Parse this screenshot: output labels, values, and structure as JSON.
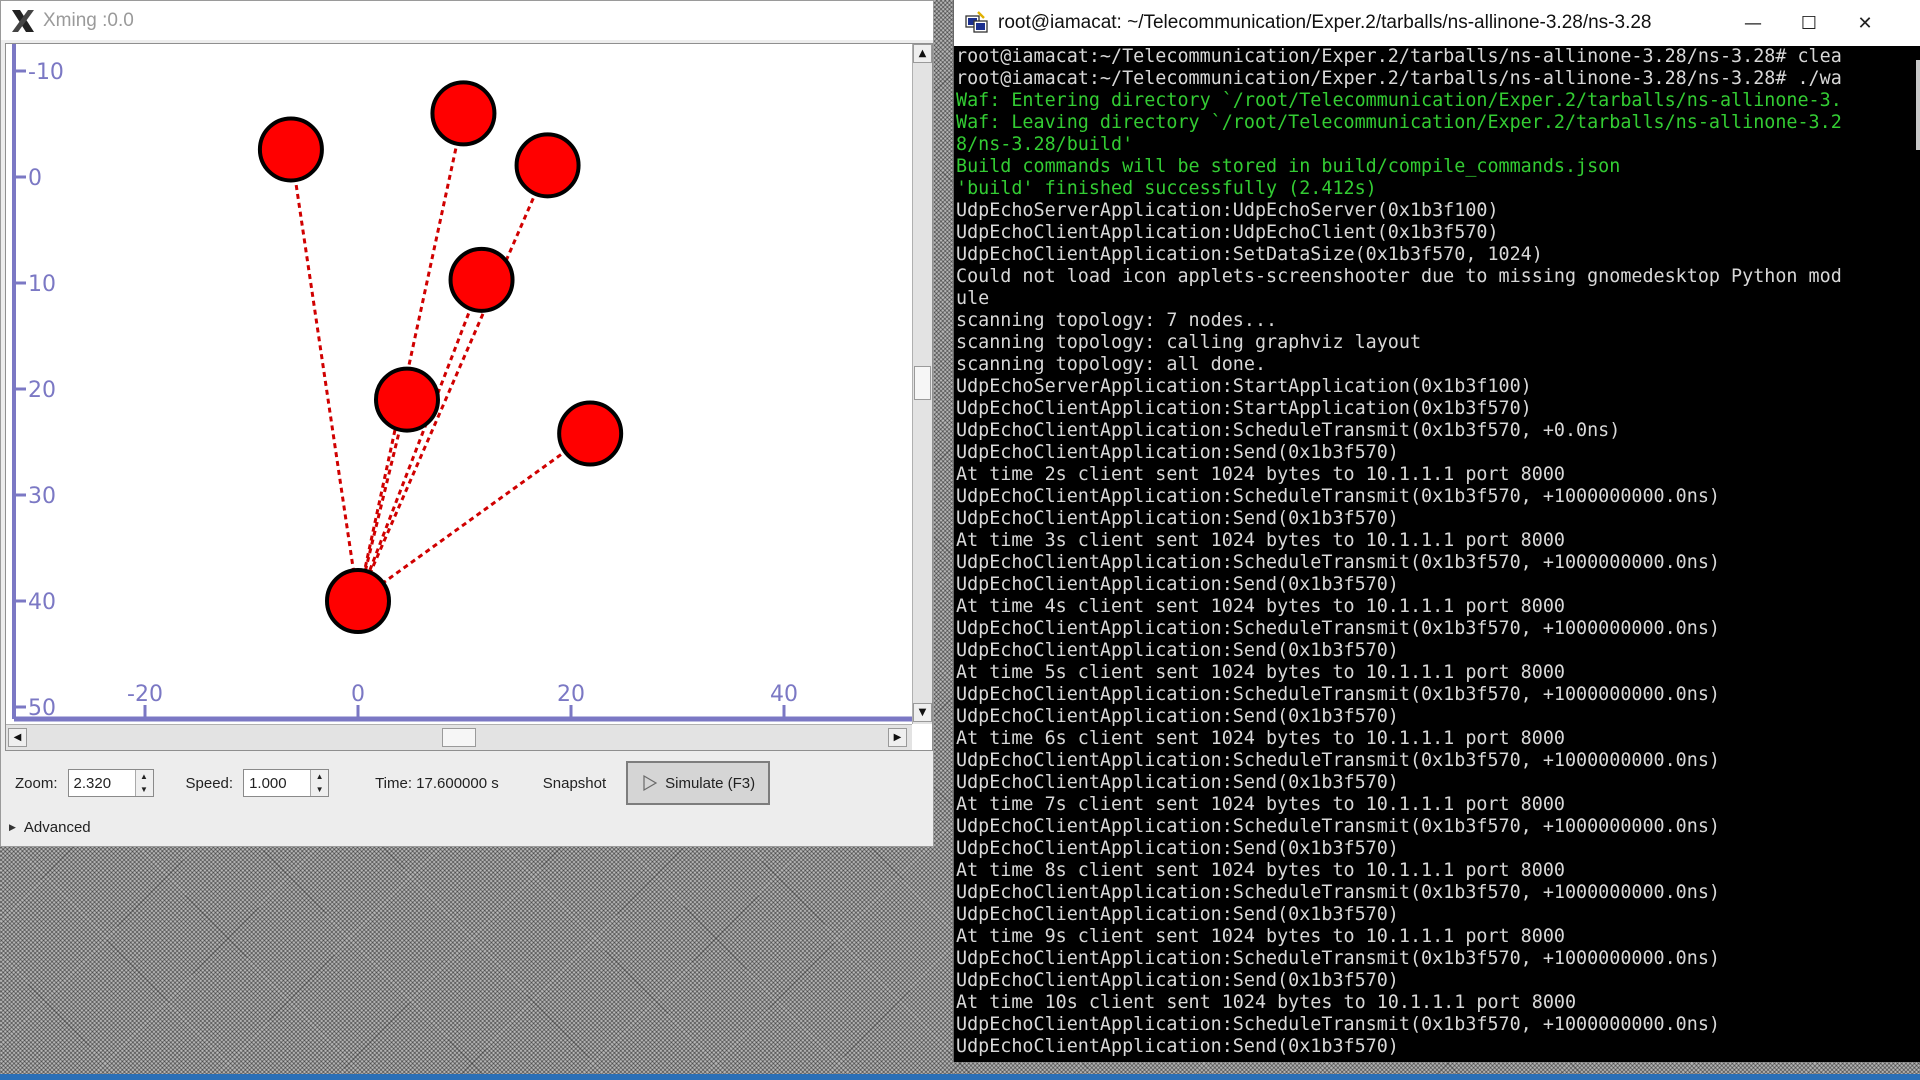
{
  "xming": {
    "title": "Xming :0.0"
  },
  "axes": {
    "x_ticks": [
      -20,
      0,
      20,
      40
    ],
    "y_ticks": [
      -10,
      0,
      10,
      20,
      30,
      40,
      50
    ],
    "x_tick_labels": [
      "-20",
      "0",
      "20",
      "40"
    ],
    "y_tick_labels": [
      "-10",
      "0",
      "10",
      "20",
      "30",
      "40",
      "50"
    ],
    "color": "#7b78c4"
  },
  "topology": {
    "nodes": [
      {
        "x": -6.3,
        "y": -2.6
      },
      {
        "x": 9.9,
        "y": -6.0
      },
      {
        "x": 17.8,
        "y": -1.1
      },
      {
        "x": 11.6,
        "y": 9.7
      },
      {
        "x": 4.6,
        "y": 21.0
      },
      {
        "x": 21.8,
        "y": 24.2
      },
      {
        "x": 0.0,
        "y": 40.0
      }
    ],
    "links": [
      [
        0,
        6
      ],
      [
        1,
        6
      ],
      [
        2,
        6
      ],
      [
        3,
        6
      ],
      [
        4,
        6
      ],
      [
        5,
        6
      ]
    ],
    "node_color": "#ff0000",
    "link_color": "#d00000"
  },
  "controls": {
    "zoom_label": "Zoom:",
    "zoom_value": "2.320",
    "speed_label": "Speed:",
    "speed_value": "1.000",
    "time_text": "Time: 17.600000 s",
    "snapshot_label": "Snapshot",
    "simulate_label": "Simulate (F3)",
    "advanced_label": "Advanced"
  },
  "terminal": {
    "title": "root@iamacat: ~/Telecommunication/Exper.2/tarballs/ns-allinone-3.28/ns-3.28",
    "lines": [
      {
        "text": "root@iamacat:~/Telecommunication/Exper.2/tarballs/ns-allinone-3.28/ns-3.28# clea",
        "color": "default"
      },
      {
        "text": "root@iamacat:~/Telecommunication/Exper.2/tarballs/ns-allinone-3.28/ns-3.28# ./wa",
        "color": "default"
      },
      {
        "text": "Waf: Entering directory `/root/Telecommunication/Exper.2/tarballs/ns-allinone-3.",
        "color": "green"
      },
      {
        "text": "Waf: Leaving directory `/root/Telecommunication/Exper.2/tarballs/ns-allinone-3.2",
        "color": "green"
      },
      {
        "text": "8/ns-3.28/build'",
        "color": "green"
      },
      {
        "text": "Build commands will be stored in build/compile_commands.json",
        "color": "green"
      },
      {
        "text": "'build' finished successfully (2.412s)",
        "color": "green"
      },
      {
        "text": "UdpEchoServerApplication:UdpEchoServer(0x1b3f100)",
        "color": "default"
      },
      {
        "text": "UdpEchoClientApplication:UdpEchoClient(0x1b3f570)",
        "color": "default"
      },
      {
        "text": "UdpEchoClientApplication:SetDataSize(0x1b3f570, 1024)",
        "color": "default"
      },
      {
        "text": "Could not load icon applets-screenshooter due to missing gnomedesktop Python mod",
        "color": "default"
      },
      {
        "text": "ule",
        "color": "default"
      },
      {
        "text": "scanning topology: 7 nodes...",
        "color": "default"
      },
      {
        "text": "scanning topology: calling graphviz layout",
        "color": "default"
      },
      {
        "text": "scanning topology: all done.",
        "color": "default"
      },
      {
        "text": "UdpEchoServerApplication:StartApplication(0x1b3f100)",
        "color": "default"
      },
      {
        "text": "UdpEchoClientApplication:StartApplication(0x1b3f570)",
        "color": "default"
      },
      {
        "text": "UdpEchoClientApplication:ScheduleTransmit(0x1b3f570, +0.0ns)",
        "color": "default"
      },
      {
        "text": "UdpEchoClientApplication:Send(0x1b3f570)",
        "color": "default"
      },
      {
        "text": "At time 2s client sent 1024 bytes to 10.1.1.1 port 8000",
        "color": "default"
      },
      {
        "text": "UdpEchoClientApplication:ScheduleTransmit(0x1b3f570, +1000000000.0ns)",
        "color": "default"
      },
      {
        "text": "UdpEchoClientApplication:Send(0x1b3f570)",
        "color": "default"
      },
      {
        "text": "At time 3s client sent 1024 bytes to 10.1.1.1 port 8000",
        "color": "default"
      },
      {
        "text": "UdpEchoClientApplication:ScheduleTransmit(0x1b3f570, +1000000000.0ns)",
        "color": "default"
      },
      {
        "text": "UdpEchoClientApplication:Send(0x1b3f570)",
        "color": "default"
      },
      {
        "text": "At time 4s client sent 1024 bytes to 10.1.1.1 port 8000",
        "color": "default"
      },
      {
        "text": "UdpEchoClientApplication:ScheduleTransmit(0x1b3f570, +1000000000.0ns)",
        "color": "default"
      },
      {
        "text": "UdpEchoClientApplication:Send(0x1b3f570)",
        "color": "default"
      },
      {
        "text": "At time 5s client sent 1024 bytes to 10.1.1.1 port 8000",
        "color": "default"
      },
      {
        "text": "UdpEchoClientApplication:ScheduleTransmit(0x1b3f570, +1000000000.0ns)",
        "color": "default"
      },
      {
        "text": "UdpEchoClientApplication:Send(0x1b3f570)",
        "color": "default"
      },
      {
        "text": "At time 6s client sent 1024 bytes to 10.1.1.1 port 8000",
        "color": "default"
      },
      {
        "text": "UdpEchoClientApplication:ScheduleTransmit(0x1b3f570, +1000000000.0ns)",
        "color": "default"
      },
      {
        "text": "UdpEchoClientApplication:Send(0x1b3f570)",
        "color": "default"
      },
      {
        "text": "At time 7s client sent 1024 bytes to 10.1.1.1 port 8000",
        "color": "default"
      },
      {
        "text": "UdpEchoClientApplication:ScheduleTransmit(0x1b3f570, +1000000000.0ns)",
        "color": "default"
      },
      {
        "text": "UdpEchoClientApplication:Send(0x1b3f570)",
        "color": "default"
      },
      {
        "text": "At time 8s client sent 1024 bytes to 10.1.1.1 port 8000",
        "color": "default"
      },
      {
        "text": "UdpEchoClientApplication:ScheduleTransmit(0x1b3f570, +1000000000.0ns)",
        "color": "default"
      },
      {
        "text": "UdpEchoClientApplication:Send(0x1b3f570)",
        "color": "default"
      },
      {
        "text": "At time 9s client sent 1024 bytes to 10.1.1.1 port 8000",
        "color": "default"
      },
      {
        "text": "UdpEchoClientApplication:ScheduleTransmit(0x1b3f570, +1000000000.0ns)",
        "color": "default"
      },
      {
        "text": "UdpEchoClientApplication:Send(0x1b3f570)",
        "color": "default"
      },
      {
        "text": "At time 10s client sent 1024 bytes to 10.1.1.1 port 8000",
        "color": "default"
      },
      {
        "text": "UdpEchoClientApplication:ScheduleTransmit(0x1b3f570, +1000000000.0ns)",
        "color": "default"
      },
      {
        "text": "UdpEchoClientApplication:Send(0x1b3f570)",
        "color": "default"
      }
    ]
  }
}
